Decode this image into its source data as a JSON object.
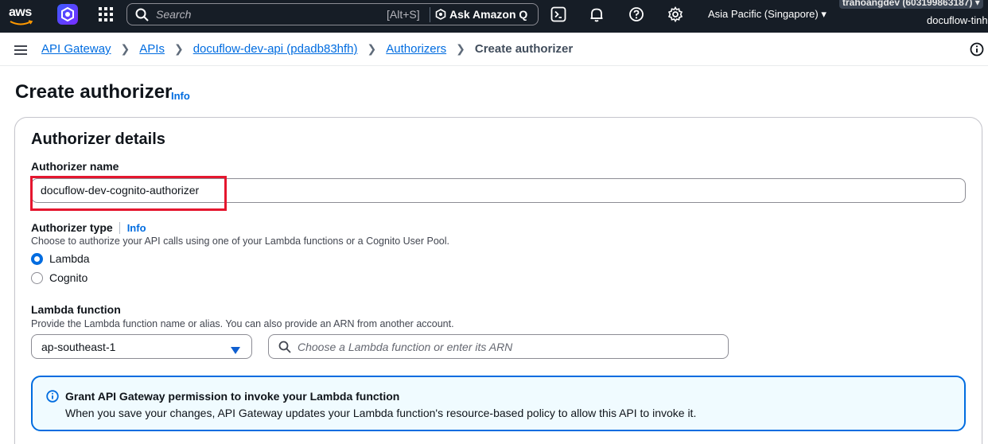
{
  "topnav": {
    "logo_text": "aws",
    "search_placeholder": "Search",
    "search_shortcut": "[Alt+S]",
    "ask_q_label": "Ask Amazon Q",
    "region_label": "Asia Pacific (Singapore) ▾",
    "account_id": "trahoangdev (603199863187) ▾",
    "account_name": "docuflow-tinh",
    "icons": [
      "cloudshell-icon",
      "bell-icon",
      "help-icon",
      "gear-icon"
    ]
  },
  "breadcrumb": {
    "items": [
      "API Gateway",
      "APIs",
      "docuflow-dev-api (pdadb83hfh)",
      "Authorizers"
    ],
    "current": "Create authorizer"
  },
  "page": {
    "title": "Create authorizer",
    "info_link": "Info"
  },
  "form": {
    "section_title": "Authorizer details",
    "name_label": "Authorizer name",
    "name_value": "docuflow-dev-cognito-authorizer",
    "type_label": "Authorizer type",
    "type_info": "Info",
    "type_desc": "Choose to authorize your API calls using one of your Lambda functions or a Cognito User Pool.",
    "type_options": [
      "Lambda",
      "Cognito"
    ],
    "type_selected": "Lambda",
    "lambda_label": "Lambda function",
    "lambda_desc": "Provide the Lambda function name or alias. You can also provide an ARN from another account.",
    "region_select_value": "ap-southeast-1",
    "lambda_placeholder": "Choose a Lambda function or enter its ARN"
  },
  "alert": {
    "title": "Grant API Gateway permission to invoke your Lambda function",
    "body": "When you save your changes, API Gateway updates your Lambda function's resource-based policy to allow this API to invoke it."
  },
  "colors": {
    "nav_bg": "#161d26",
    "link": "#006ce0",
    "highlight": "#e5162e",
    "alert_bg": "#f0fbff"
  }
}
